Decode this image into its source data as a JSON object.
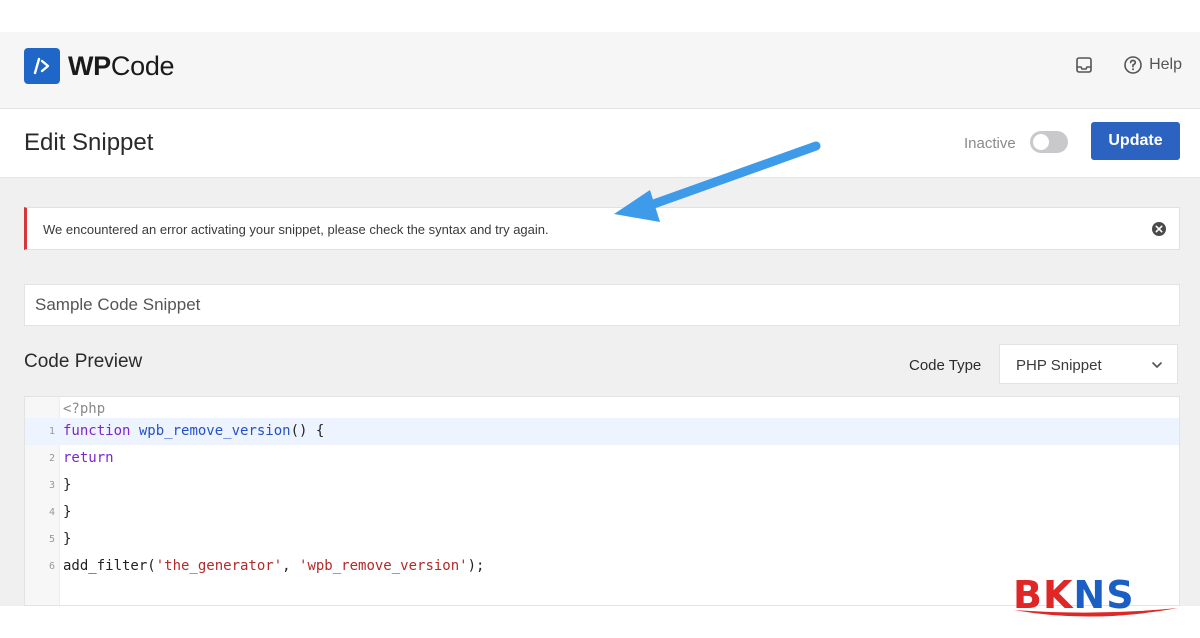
{
  "app": {
    "brand_prefix": "WP",
    "brand_suffix": "Code",
    "help_label": "Help"
  },
  "header": {
    "title": "Edit Snippet",
    "status_label": "Inactive",
    "active": false,
    "update_label": "Update"
  },
  "notice": {
    "message": "We encountered an error activating your snippet, please check the syntax and try again."
  },
  "snippet": {
    "title_value": "Sample Code Snippet"
  },
  "preview": {
    "heading": "Code Preview",
    "code_type_label": "Code Type",
    "code_type_value": "PHP Snippet"
  },
  "code": {
    "header_line": "<?php",
    "lines": [
      {
        "n": "1",
        "kw": "function",
        "fn": "wpb_remove_version",
        "rest": "() {"
      },
      {
        "n": "2",
        "kw": "return"
      },
      {
        "n": "3",
        "text": "}"
      },
      {
        "n": "4",
        "text": "}"
      },
      {
        "n": "5",
        "text": "}"
      },
      {
        "n": "6",
        "pre": "add_filter(",
        "s1": "'the_generator'",
        "mid": ", ",
        "s2": "'wpb_remove_version'",
        "post": ");"
      }
    ]
  },
  "watermark": {
    "part1": "BK",
    "part2": "NS"
  },
  "colors": {
    "accent": "#2c63c1",
    "error": "#d63638",
    "annotation_arrow": "#3d9be9",
    "watermark_red": "#e02727",
    "watermark_blue": "#1b5fc4"
  },
  "icons": [
    "wpcode-logo-icon",
    "inbox-icon",
    "help-circle-icon",
    "close-circle-icon",
    "chevron-down-icon",
    "arrow-annotation-icon"
  ]
}
